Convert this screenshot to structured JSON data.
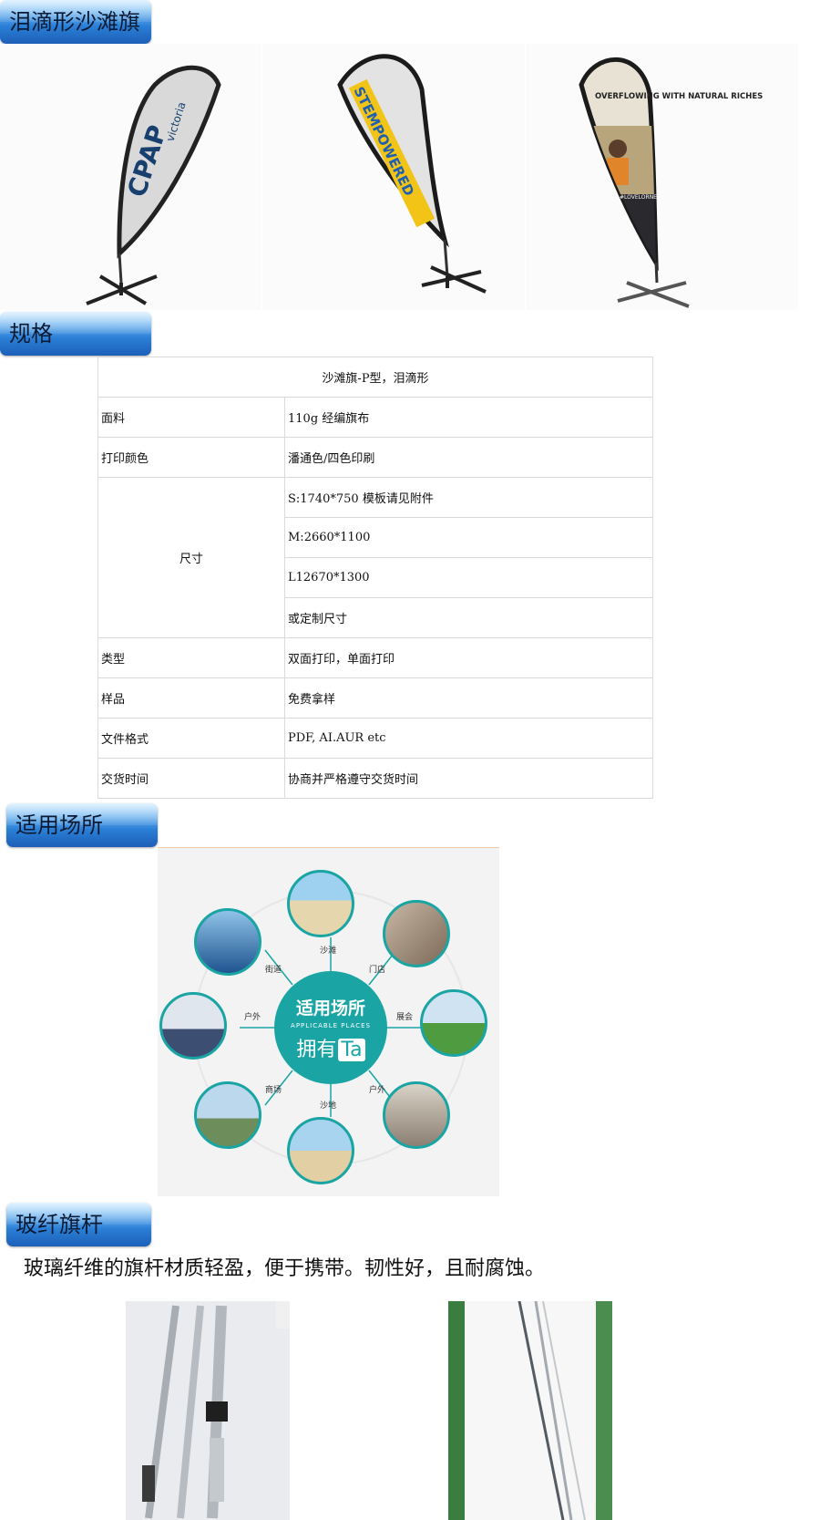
{
  "sections": {
    "teardrop": "泪滴形沙滩旗",
    "spec": "规格",
    "venues": "适用场所",
    "pole": "玻纤旗杆"
  },
  "flags": [
    {
      "text": "CPAP",
      "subtext": "victoria"
    },
    {
      "text": "STEMPOWERED"
    },
    {
      "text": "OVERFLOWING WITH NATURAL RICHES",
      "tag": "#LOVELORNE"
    }
  ],
  "spec_table": {
    "header": "沙滩旗-P型，泪滴形",
    "rows": [
      {
        "label": "面料",
        "value": "110g 经编旗布"
      },
      {
        "label": "打印颜色",
        "value": "潘通色/四色印刷"
      },
      {
        "label": "尺寸",
        "values": [
          "S:1740*750 模板请见附件",
          "M:2660*1100",
          "L12670*1300",
          "或定制尺寸"
        ]
      },
      {
        "label": "类型",
        "value": "双面打印，单面打印"
      },
      {
        "label": "样品",
        "value": "免费拿样"
      },
      {
        "label": "文件格式",
        "value": "PDF, AI.AUR etc"
      },
      {
        "label": "交货时间",
        "value": "协商并严格遵守交货时间"
      }
    ]
  },
  "venues": {
    "title": "适用场所",
    "subtitle": "APPLICABLE PLACES",
    "tagline_a": "拥有",
    "tagline_b": "Ta",
    "labels": [
      "沙滩",
      "门店",
      "展会",
      "户外",
      "沙地",
      "商场",
      "户外",
      "街道"
    ]
  },
  "pole_description": "玻璃纤维的旗杆材质轻盈，便于携带。韧性好，且耐腐蚀。",
  "colors": {
    "tab_blue": "#2a7fd6",
    "teal": "#1aa4a4",
    "stem_yellow": "#f2c418",
    "stem_blue": "#1f5fb0",
    "stem_red": "#d8322a"
  }
}
